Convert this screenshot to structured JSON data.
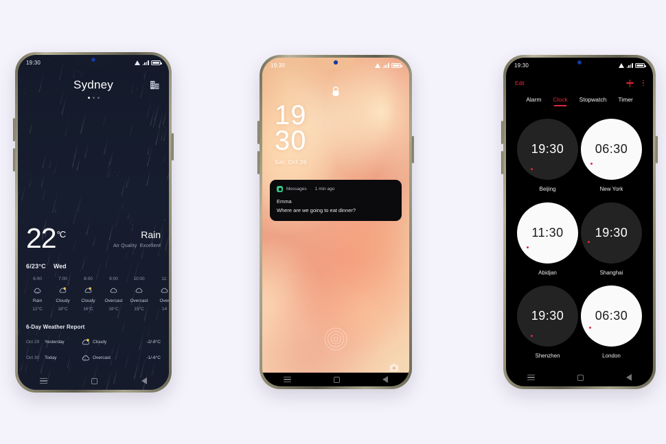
{
  "scene": {
    "background_color": "#f4f2fb",
    "device_frame_color": "#8d8a72"
  },
  "phone_weather": {
    "status_bar": {
      "time": "19:30",
      "wifi_icon": "wifi-icon",
      "signal_icon": "signal-bars-icon",
      "battery_icon": "battery-icon"
    },
    "city": "Sydney",
    "city_list_icon": "city-buildings-icon",
    "page_dots": {
      "count": 3,
      "active_index": 0
    },
    "current": {
      "temperature": "22",
      "unit": "°C",
      "condition": "Rain",
      "air_quality_label": "Air Quality",
      "air_quality_value": "Excellent"
    },
    "range": "6/23°C",
    "weekday": "Wed",
    "hourly": [
      {
        "time": "6:00",
        "icon": "rain-icon",
        "condition": "Rain",
        "temp": "12°C"
      },
      {
        "time": "7:00",
        "icon": "partly-cloudy-icon",
        "condition": "Cloudy",
        "temp": "18°C"
      },
      {
        "time": "8:00",
        "icon": "partly-cloudy-icon",
        "condition": "Cloudy",
        "temp": "16°C"
      },
      {
        "time": "9:00",
        "icon": "cloud-icon",
        "condition": "Overcast",
        "temp": "16°C"
      },
      {
        "time": "10:00",
        "icon": "cloud-icon",
        "condition": "Overcast",
        "temp": "15°C"
      },
      {
        "time": "11:",
        "icon": "cloud-icon",
        "condition": "Over",
        "temp": "14"
      }
    ],
    "forecast_title": "6-Day Weather Report",
    "forecast": [
      {
        "date": "Oct 29",
        "label": "Yesterday",
        "icon": "partly-cloudy-icon",
        "condition": "Cloudy",
        "temps": "-2/-8°C"
      },
      {
        "date": "Oct 30",
        "label": "Today",
        "icon": "cloud-icon",
        "condition": "Overcast",
        "temps": "-1/-6°C"
      }
    ],
    "nav_bar": {
      "recents_icon": "recents-icon",
      "home_icon": "home-icon",
      "back_icon": "back-icon"
    }
  },
  "phone_lock": {
    "status_bar": {
      "time": "19:30",
      "wifi_icon": "wifi-icon",
      "signal_icon": "signal-bars-icon",
      "battery_icon": "battery-icon"
    },
    "lock_icon": "lock-icon",
    "clock_hour": "19",
    "clock_minute": "30",
    "date": "Sat, Oct 26",
    "notification": {
      "app_icon": "messages-icon",
      "app_name": "Messages",
      "separator": "·",
      "time_ago": "1 min ago",
      "sender": "Emma",
      "message": "Where are we going to eat dinner?"
    },
    "fingerprint_icon": "fingerprint-icon",
    "camera_shortcut_icon": "camera-icon",
    "nav_bar": {
      "recents_icon": "recents-icon",
      "home_icon": "home-icon",
      "back_icon": "back-icon"
    }
  },
  "phone_clock": {
    "status_bar": {
      "time": "19:30",
      "wifi_icon": "wifi-icon",
      "signal_icon": "signal-bars-icon",
      "battery_icon": "battery-icon"
    },
    "edit_label": "Edit",
    "add_icon": "plus-icon",
    "more_icon": "more-vertical-icon",
    "accent_color": "#e0283c",
    "tabs": [
      {
        "label": "Alarm",
        "active": false
      },
      {
        "label": "Clock",
        "active": true
      },
      {
        "label": "Stopwatch",
        "active": false
      },
      {
        "label": "Timer",
        "active": false
      }
    ],
    "clocks": [
      {
        "time": "19:30",
        "city": "Beijing",
        "theme": "dark"
      },
      {
        "time": "06:30",
        "city": "New York",
        "theme": "light"
      },
      {
        "time": "11:30",
        "city": "Abidjan",
        "theme": "light"
      },
      {
        "time": "19:30",
        "city": "Shanghai",
        "theme": "dark"
      },
      {
        "time": "19:30",
        "city": "Shenzhen",
        "theme": "dark"
      },
      {
        "time": "06:30",
        "city": "London",
        "theme": "light"
      }
    ],
    "nav_bar": {
      "recents_icon": "recents-icon",
      "home_icon": "home-icon",
      "back_icon": "back-icon"
    }
  }
}
